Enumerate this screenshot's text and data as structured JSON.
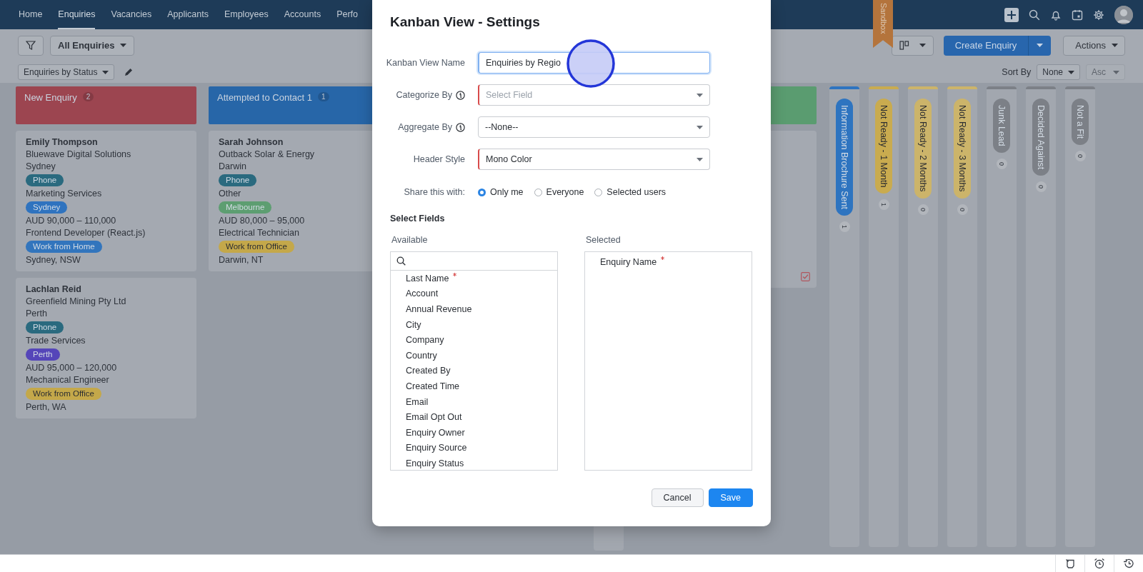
{
  "nav": {
    "items": [
      {
        "label": "Home",
        "selected": false
      },
      {
        "label": "Enquiries",
        "selected": true
      },
      {
        "label": "Vacancies",
        "selected": false
      },
      {
        "label": "Applicants",
        "selected": false
      },
      {
        "label": "Employees",
        "selected": false
      },
      {
        "label": "Accounts",
        "selected": false
      },
      {
        "label": "Perfo",
        "selected": false
      }
    ]
  },
  "sandbox_ribbon": "Sandbox",
  "toolbar": {
    "view_filter": "All Enquiries",
    "create_button": "Create Enquiry",
    "actions_button": "Actions"
  },
  "subbar": {
    "layout": "Enquiries by Status",
    "sort_label": "Sort By",
    "sort_field": "None",
    "sort_order": {
      "label": "Asc",
      "disabled": true
    }
  },
  "board": {
    "columns": [
      {
        "kind": "expanded",
        "title": "New Enquiry",
        "count": "2",
        "color": "#9c4550",
        "cards": [
          {
            "name": "Emily Thompson",
            "lines": [
              {
                "kind": "text",
                "text": "Bluewave Digital Solutions"
              },
              {
                "kind": "text",
                "text": "Sydney"
              },
              {
                "kind": "tag",
                "text": "Phone",
                "color": "#2a6a7f"
              },
              {
                "kind": "text",
                "text": "Marketing Services"
              },
              {
                "kind": "tag",
                "text": "Sydney",
                "color": "#2f73bf"
              },
              {
                "kind": "text",
                "text": "AUD 90,000 – 110,000"
              },
              {
                "kind": "text",
                "text": "Frontend Developer (React.js)"
              },
              {
                "kind": "tag",
                "text": "Work from Home",
                "color": "#3275bd"
              },
              {
                "kind": "text",
                "text": "Sydney, NSW"
              }
            ]
          },
          {
            "name": "Lachlan Reid",
            "lines": [
              {
                "kind": "text",
                "text": "Greenfield Mining Pty Ltd"
              },
              {
                "kind": "text",
                "text": "Perth"
              },
              {
                "kind": "tag",
                "text": "Phone",
                "color": "#2a6a7f"
              },
              {
                "kind": "text",
                "text": "Trade Services"
              },
              {
                "kind": "tag",
                "text": "Perth",
                "color": "#5546b9"
              },
              {
                "kind": "text",
                "text": "AUD 95,000 – 120,000"
              },
              {
                "kind": "text",
                "text": "Mechanical Engineer"
              },
              {
                "kind": "tag",
                "text": "Work from Office",
                "color": "#c4a84a"
              },
              {
                "kind": "text",
                "text": "Perth, WA"
              }
            ]
          }
        ]
      },
      {
        "kind": "expanded",
        "title": "Attempted to Contact 1",
        "count": "1",
        "color": "#2766a8",
        "cards": [
          {
            "name": "Sarah Johnson",
            "lines": [
              {
                "kind": "text",
                "text": "Outback Solar & Energy"
              },
              {
                "kind": "text",
                "text": "Darwin"
              },
              {
                "kind": "tag",
                "text": "Phone",
                "color": "#2a6a7f"
              },
              {
                "kind": "text",
                "text": "Other"
              },
              {
                "kind": "tag",
                "text": "Melbourne",
                "color": "#5d9e71"
              },
              {
                "kind": "text",
                "text": "AUD 80,000 – 95,000"
              },
              {
                "kind": "text",
                "text": "Electrical Technician"
              },
              {
                "kind": "tag",
                "text": "Work from Office",
                "color": "#c4a84a"
              },
              {
                "kind": "text",
                "text": "Darwin, NT"
              }
            ]
          }
        ]
      },
      {
        "kind": "expanded",
        "color": "#5a9c70",
        "cards": [
          {
            "task": true
          }
        ]
      },
      {
        "kind": "collapsed",
        "title": "Information Brochure Sent",
        "count": "1",
        "color": "#2e74c0"
      },
      {
        "kind": "collapsed",
        "title": "Not Ready - 1 Month",
        "count": "1",
        "color": "#c9ab4f"
      },
      {
        "kind": "collapsed",
        "title": "Not Ready - 2 Months",
        "count": "0",
        "color": "#ccb46a"
      },
      {
        "kind": "collapsed",
        "title": "Not Ready - 3 Months",
        "count": "0",
        "color": "#ccb46a"
      },
      {
        "kind": "collapsed",
        "title": "Junk Lead",
        "count": "0",
        "color": "#7c8087"
      },
      {
        "kind": "collapsed",
        "title": "Decided Against",
        "count": "0",
        "color": "#7c8087"
      },
      {
        "kind": "collapsed",
        "title": "Not a Fit",
        "count": "0",
        "color": "#7c8087"
      }
    ]
  },
  "dialog": {
    "title": "Kanban View - Settings",
    "fields": [
      {
        "label": "Kanban View Name",
        "kind": "text",
        "value": "Enquiries by Regio",
        "required": true,
        "focused": true,
        "info": false
      },
      {
        "label": "Categorize By",
        "kind": "select",
        "placeholder": "Select Field",
        "required": true,
        "focused": false,
        "info": true
      },
      {
        "label": "Aggregate By",
        "kind": "select",
        "value": "--None--",
        "required": false,
        "focused": false,
        "info": true
      },
      {
        "label": "Header Style",
        "kind": "select",
        "value": "Mono Color",
        "required": true,
        "focused": false,
        "info": false
      }
    ],
    "share": {
      "label": "Share this with:",
      "options": [
        {
          "label": "Only me",
          "selected": true
        },
        {
          "label": "Everyone",
          "selected": false
        },
        {
          "label": "Selected users",
          "selected": false
        }
      ]
    },
    "select_fields": {
      "title": "Select Fields",
      "available_label": "Available",
      "selected_label": "Selected",
      "available": [
        {
          "label": "Last Name",
          "required": true
        },
        {
          "label": "Account",
          "required": false
        },
        {
          "label": "Annual Revenue",
          "required": false
        },
        {
          "label": "City",
          "required": false
        },
        {
          "label": "Company",
          "required": false
        },
        {
          "label": "Country",
          "required": false
        },
        {
          "label": "Created By",
          "required": false
        },
        {
          "label": "Created Time",
          "required": false
        },
        {
          "label": "Email",
          "required": false
        },
        {
          "label": "Email Opt Out",
          "required": false
        },
        {
          "label": "Enquiry Owner",
          "required": false
        },
        {
          "label": "Enquiry Source",
          "required": false
        },
        {
          "label": "Enquiry Status",
          "required": false
        }
      ],
      "selected": [
        {
          "label": "Enquiry Name",
          "required": true
        }
      ]
    },
    "buttons": [
      {
        "label": "Cancel",
        "kind": "secondary"
      },
      {
        "label": "Save",
        "kind": "primary"
      }
    ]
  }
}
